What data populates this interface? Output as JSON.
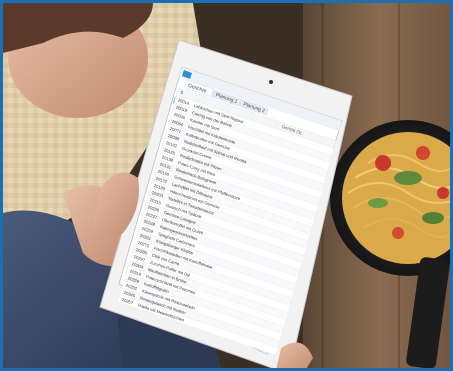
{
  "app": {
    "tabs": [
      {
        "label": "Gerichte",
        "active": true
      },
      {
        "label": "Planung 1",
        "active": false
      },
      {
        "label": "Planung 2",
        "active": false
      }
    ],
    "column_header_right": "Gericht (3)"
  },
  "rows": [
    {
      "id": "20014",
      "name": "Lebkuchen mit Senf-Ragout"
    },
    {
      "id": "20019",
      "name": "Cremig von der Bohne"
    },
    {
      "id": "20045",
      "name": "Kassler mit Senf"
    },
    {
      "id": "20064",
      "name": "Fischfilet mit Kräuterkruste"
    },
    {
      "id": "20071",
      "name": "Kalbsbraten mit Gemüse"
    },
    {
      "id": "20088",
      "name": "Nudelauflauf mit Spinat und Ricotta"
    },
    {
      "id": "20102",
      "name": "Grünkohl-Creme"
    },
    {
      "id": "20125",
      "name": "Rinderbraten mit Pilzen"
    },
    {
      "id": "20138",
      "name": "Puten-Curry mit Reis"
    },
    {
      "id": "20141",
      "name": "Rinderhack-Bolognese"
    },
    {
      "id": "20150",
      "name": "Schweinemedaillons mit Pfeffersauce"
    },
    {
      "id": "20172",
      "name": "Lachsfilet mit Dillsauce"
    },
    {
      "id": "20189",
      "name": "Hähnchenbrust mit Gemüse"
    },
    {
      "id": "20203",
      "name": "Tortellini in Tomatensauce"
    },
    {
      "id": "20215",
      "name": "Gulasch mit Spätzle"
    },
    {
      "id": "20228",
      "name": "Gemüse-Lasagne"
    },
    {
      "id": "20237",
      "name": "Ofenkartoffel mit Quark"
    },
    {
      "id": "20248",
      "name": "Rahmgeschnetzeltes"
    },
    {
      "id": "20259",
      "name": "Spaghetti Carbonara"
    },
    {
      "id": "20261",
      "name": "Königsberger Klopse"
    },
    {
      "id": "20273",
      "name": "Fischfrikadellen mit Kartoffelsalat"
    },
    {
      "id": "20285",
      "name": "Chili con Carne"
    },
    {
      "id": "20297",
      "name": "Zucchini-Puffer mit Dip"
    },
    {
      "id": "20304",
      "name": "Maultaschen in Brühe"
    },
    {
      "id": "20316",
      "name": "Putenschnitzel mit Pommes"
    },
    {
      "id": "20328",
      "name": "Kartoffelgratin"
    },
    {
      "id": "20332",
      "name": "Käsespätzle mit Röstzwiebeln"
    },
    {
      "id": "20345",
      "name": "Rindergulasch mit Nudeln"
    },
    {
      "id": "20357",
      "name": "Paella mit Meeresfrüchten"
    }
  ],
  "colors": {
    "border": "#1a6fb5",
    "tablet_body": "#f2f2f2",
    "screen_bg": "#ffffff",
    "accent": "#2d8fd5"
  }
}
